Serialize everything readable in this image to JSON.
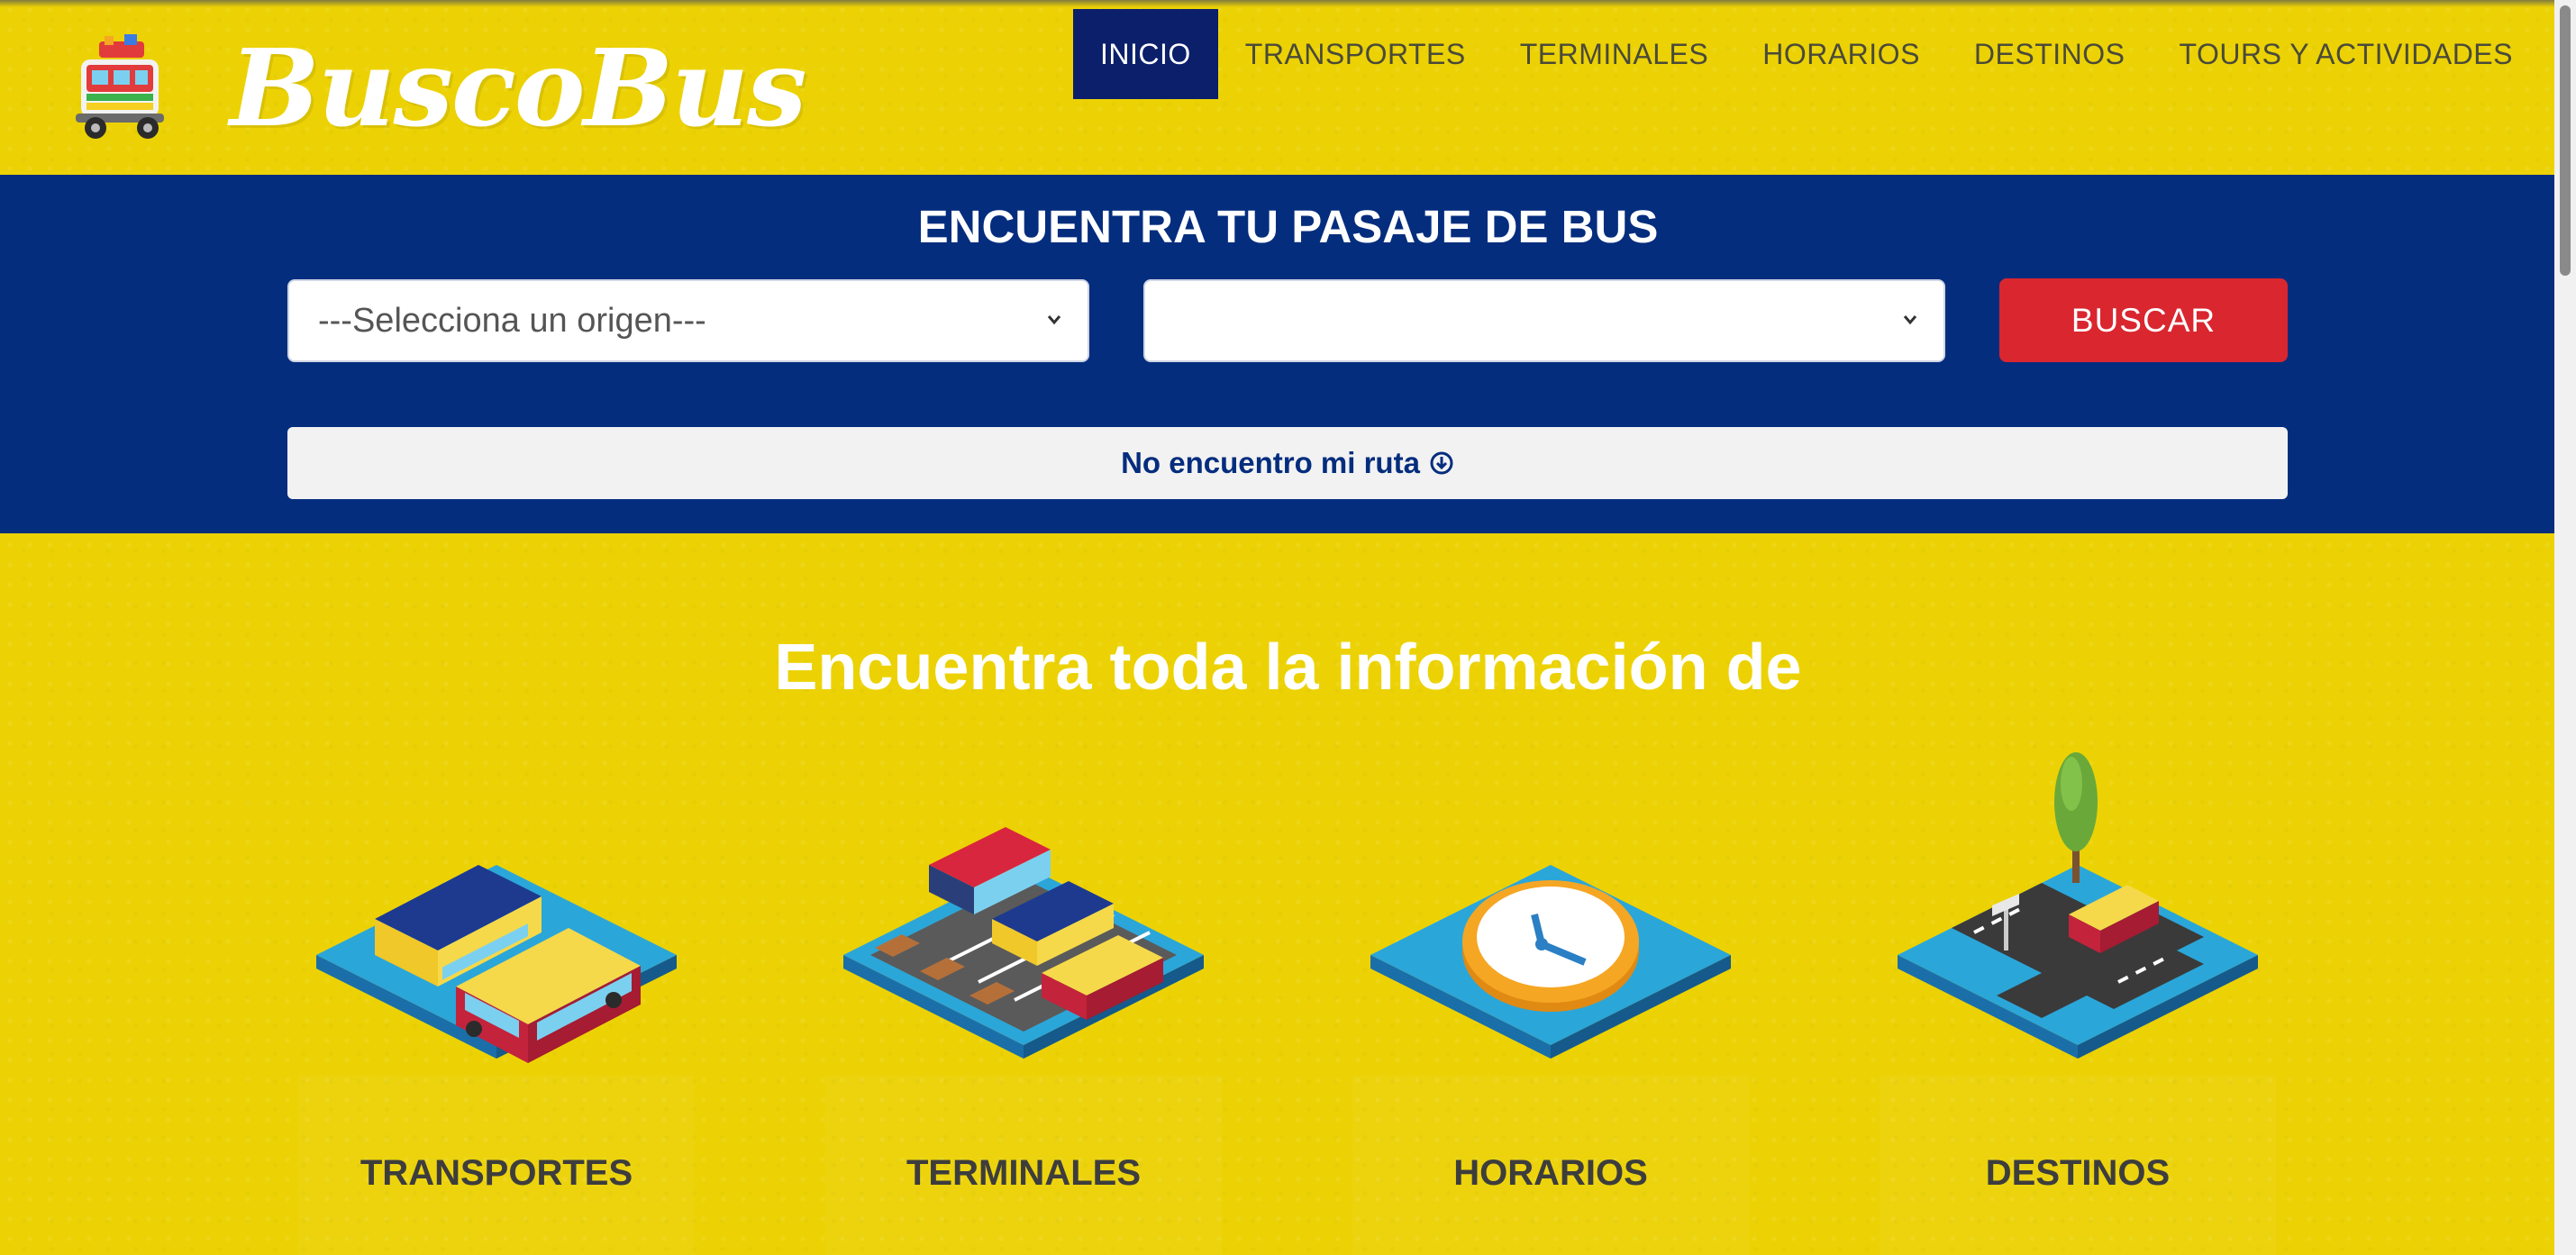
{
  "brand": {
    "name": "BuscoBus",
    "logo_icon": "bus-logo-icon"
  },
  "nav": {
    "items": [
      {
        "label": "INICIO",
        "active": true
      },
      {
        "label": "TRANSPORTES",
        "active": false
      },
      {
        "label": "TERMINALES",
        "active": false
      },
      {
        "label": "HORARIOS",
        "active": false
      },
      {
        "label": "DESTINOS",
        "active": false
      },
      {
        "label": "TOURS Y ACTIVIDADES",
        "active": false
      }
    ]
  },
  "search": {
    "title": "ENCUENTRA TU PASAJE DE BUS",
    "origin_selected": "---Selecciona un origen---",
    "destination_selected": "",
    "button_label": "BUSCAR",
    "no_route_label": "No encuentro mi ruta"
  },
  "info": {
    "title": "Encuentra toda la información de",
    "cards": [
      {
        "label": "TRANSPORTES",
        "icon": "buses-icon"
      },
      {
        "label": "TERMINALES",
        "icon": "terminal-icon"
      },
      {
        "label": "HORARIOS",
        "icon": "clock-icon"
      },
      {
        "label": "DESTINOS",
        "icon": "crossroad-icon"
      }
    ]
  },
  "colors": {
    "background_yellow": "#ecd204",
    "navy": "#042d7e",
    "nav_active": "#0b1f6b",
    "button_red": "#d9262f",
    "tile_blue": "#2ba6d9"
  }
}
